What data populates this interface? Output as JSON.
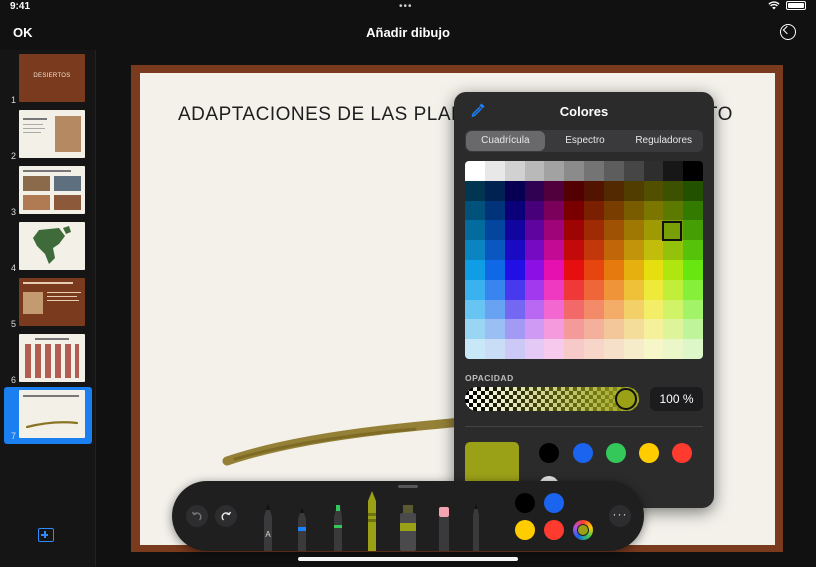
{
  "status": {
    "time": "9:41"
  },
  "nav": {
    "ok_label": "OK",
    "title": "Añadir dibujo"
  },
  "sidebar": {
    "slides": [
      {
        "number": "1",
        "title": "DESIERTOS"
      },
      {
        "number": "2"
      },
      {
        "number": "3"
      },
      {
        "number": "4"
      },
      {
        "number": "5"
      },
      {
        "number": "6"
      },
      {
        "number": "7"
      }
    ],
    "selected_slide": "7"
  },
  "slide": {
    "title_part1": "ADAPTACIONES DE LAS PLANTAS",
    "title_part2": "RTO"
  },
  "colors_popover": {
    "title": "Colores",
    "tabs": [
      "Cuadrícula",
      "Espectro",
      "Reguladores"
    ],
    "active_tab": "Cuadrícula",
    "opacity_label": "OPACIDAD",
    "opacity_value": "100 %",
    "current_color": "#9BA117",
    "saved_colors": [
      "#000000",
      "#1A64F0",
      "#34C759",
      "#FFCC00",
      "#FF3B30"
    ]
  },
  "toolbar": {
    "tools": [
      "pencil",
      "pen",
      "marker",
      "crayon",
      "fill",
      "eraser",
      "smudge"
    ],
    "quick_colors": [
      "#000000",
      "#1A64F0",
      "#FFCC00",
      "#FF3B30"
    ],
    "selected_color": "#9BA117"
  }
}
